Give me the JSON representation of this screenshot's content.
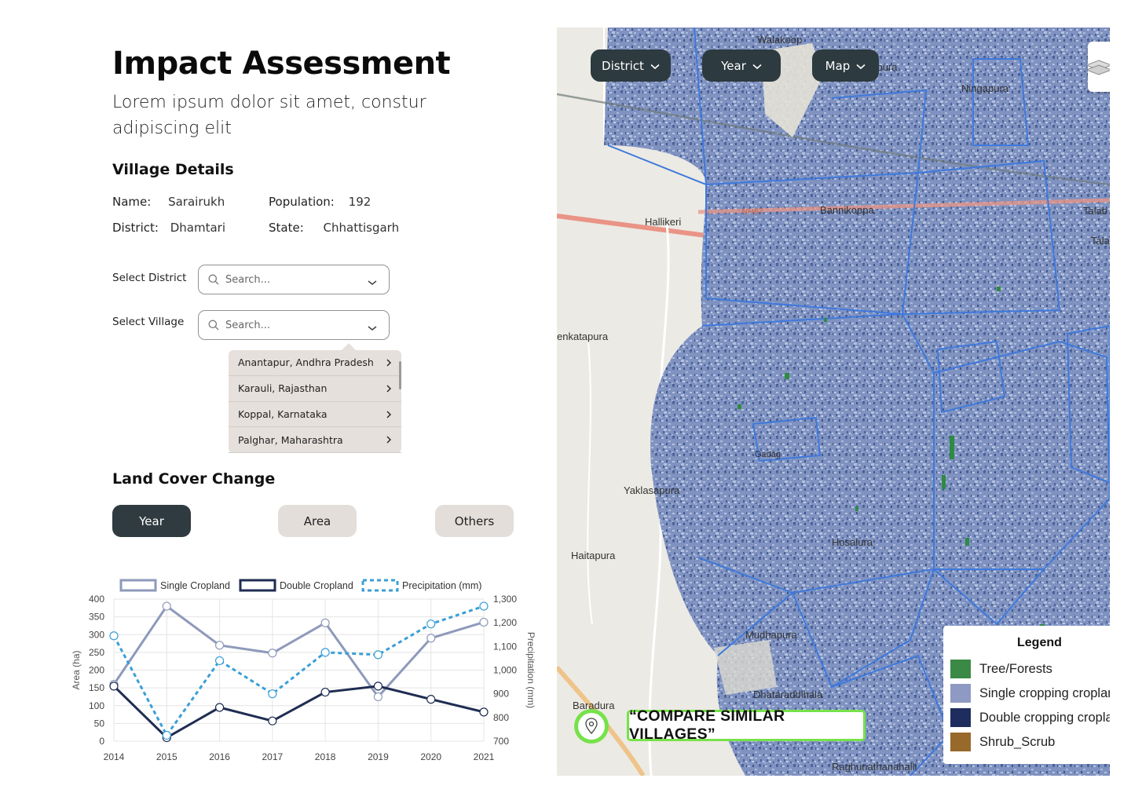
{
  "header": {
    "title": "Impact Assessment",
    "subtitle": "Lorem ipsum dolor sit amet, constur adipiscing elit"
  },
  "village_details": {
    "heading": "Village Details",
    "name_label": "Name:",
    "name_value": "Sarairukh",
    "population_label": "Population:",
    "population_value": "192",
    "district_label": "District:",
    "district_value": "Dhamtari",
    "state_label": "State:",
    "state_value": "Chhattisgarh"
  },
  "filters": {
    "district_label": "Select District",
    "district_placeholder": "Search...",
    "village_label": "Select Village",
    "village_placeholder": "Search...",
    "village_options": [
      "Anantapur, Andhra Pradesh",
      "Karauli, Rajasthan",
      "Koppal, Karnataka",
      "Palghar, Maharashtra"
    ]
  },
  "land_cover": {
    "heading": "Land Cover Change",
    "tabs": [
      {
        "label": "Year",
        "active": true
      },
      {
        "label": "Area",
        "active": false
      },
      {
        "label": "Others",
        "active": false
      }
    ]
  },
  "chart_data": {
    "type": "line",
    "x": [
      2014,
      2015,
      2016,
      2017,
      2018,
      2019,
      2020,
      2021
    ],
    "series": [
      {
        "name": "Single Cropland",
        "axis": "left",
        "color": "#8e9abb",
        "dashed": false,
        "values": [
          160,
          380,
          270,
          248,
          333,
          125,
          290,
          335
        ]
      },
      {
        "name": "Double Cropland",
        "axis": "left",
        "color": "#1f2d52",
        "dashed": false,
        "values": [
          155,
          10,
          95,
          57,
          138,
          155,
          118,
          82
        ]
      },
      {
        "name": "Precipitation (mm)",
        "axis": "right",
        "color": "#3a9fd6",
        "dashed": true,
        "values": [
          1145,
          725,
          1040,
          900,
          1075,
          1065,
          1195,
          1270
        ]
      }
    ],
    "ylabel": "Area (ha)",
    "y2label": "Precipitation (mm)",
    "ylim": [
      0,
      400
    ],
    "y2lim": [
      700,
      1300
    ],
    "yticks": [
      "0",
      "50",
      "100",
      "150",
      "200",
      "250",
      "300",
      "350",
      "400"
    ],
    "y2ticks": [
      "700",
      "800",
      "900",
      "1,000",
      "1,100",
      "1,200",
      "1,300"
    ],
    "grid": true,
    "legend_position": "top"
  },
  "map": {
    "buttons": [
      {
        "label": "District"
      },
      {
        "label": "Year"
      },
      {
        "label": "Map"
      }
    ],
    "place_labels": [
      "Hallikeri",
      "NH67",
      "Bannikoppa",
      "Ningapura",
      "enkatapura",
      "Yaklasapura",
      "Haitapura",
      "Gadag",
      "Hosalura",
      "Mudhapura",
      "Baradura",
      "Dhataraddihala",
      "Raghunathanahalli",
      "Walakoop",
      "Hatapura",
      "Talab",
      "Talak"
    ],
    "legend": {
      "title": "Legend",
      "items": [
        {
          "label": "Tree/Forests",
          "color": "#3a8a46"
        },
        {
          "label": "Single cropping cropland",
          "color": "#8e9ac4"
        },
        {
          "label": "Double cropping cropland",
          "color": "#1f2d5e"
        },
        {
          "label": "Shrub_Scrub",
          "color": "#97692a"
        }
      ]
    },
    "compare_label": "“COMPARE SIMILAR VILLAGES”"
  }
}
